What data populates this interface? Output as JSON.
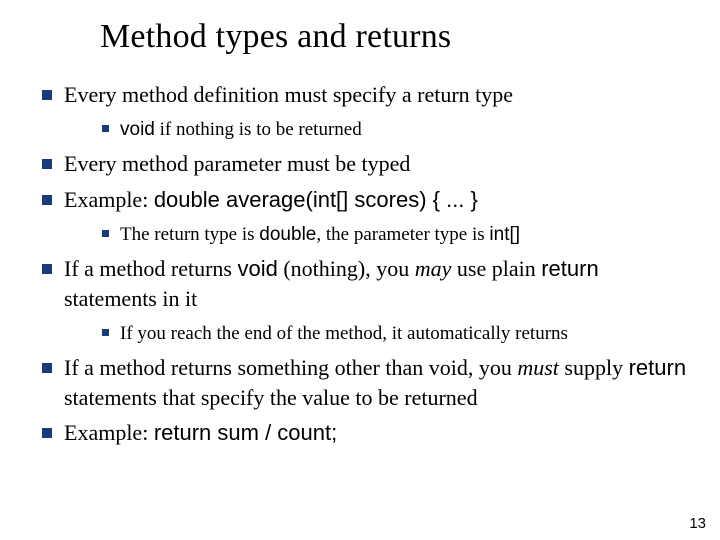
{
  "title": "Method types and returns",
  "bullets": {
    "b1": "Every method definition must specify a return type",
    "b1_1_code": "void",
    "b1_1_rest": " if nothing is to be returned",
    "b2": "Every method parameter must be typed",
    "b3_pre": "Example: ",
    "b3_code": "double average(int[] scores) { ... }",
    "b3_1_pre": "The return type is ",
    "b3_1_code1": "double",
    "b3_1_mid": ", the parameter type is ",
    "b3_1_code2": "int[]",
    "b4_pre": "If a method returns ",
    "b4_code": "void",
    "b4_mid": " (nothing), you ",
    "b4_may": "may",
    "b4_mid2": " use plain ",
    "b4_code2": "return",
    "b4_end": " statements in it",
    "b4_1": "If you reach the end of the method, it automatically returns",
    "b5_pre": "If a method returns something other than void, you ",
    "b5_must": "must",
    "b5_mid": " supply ",
    "b5_code": "return",
    "b5_end": " statements that specify the value to be returned",
    "b6_pre": "Example: ",
    "b6_code": "return sum / count;"
  },
  "pagenum": "13"
}
